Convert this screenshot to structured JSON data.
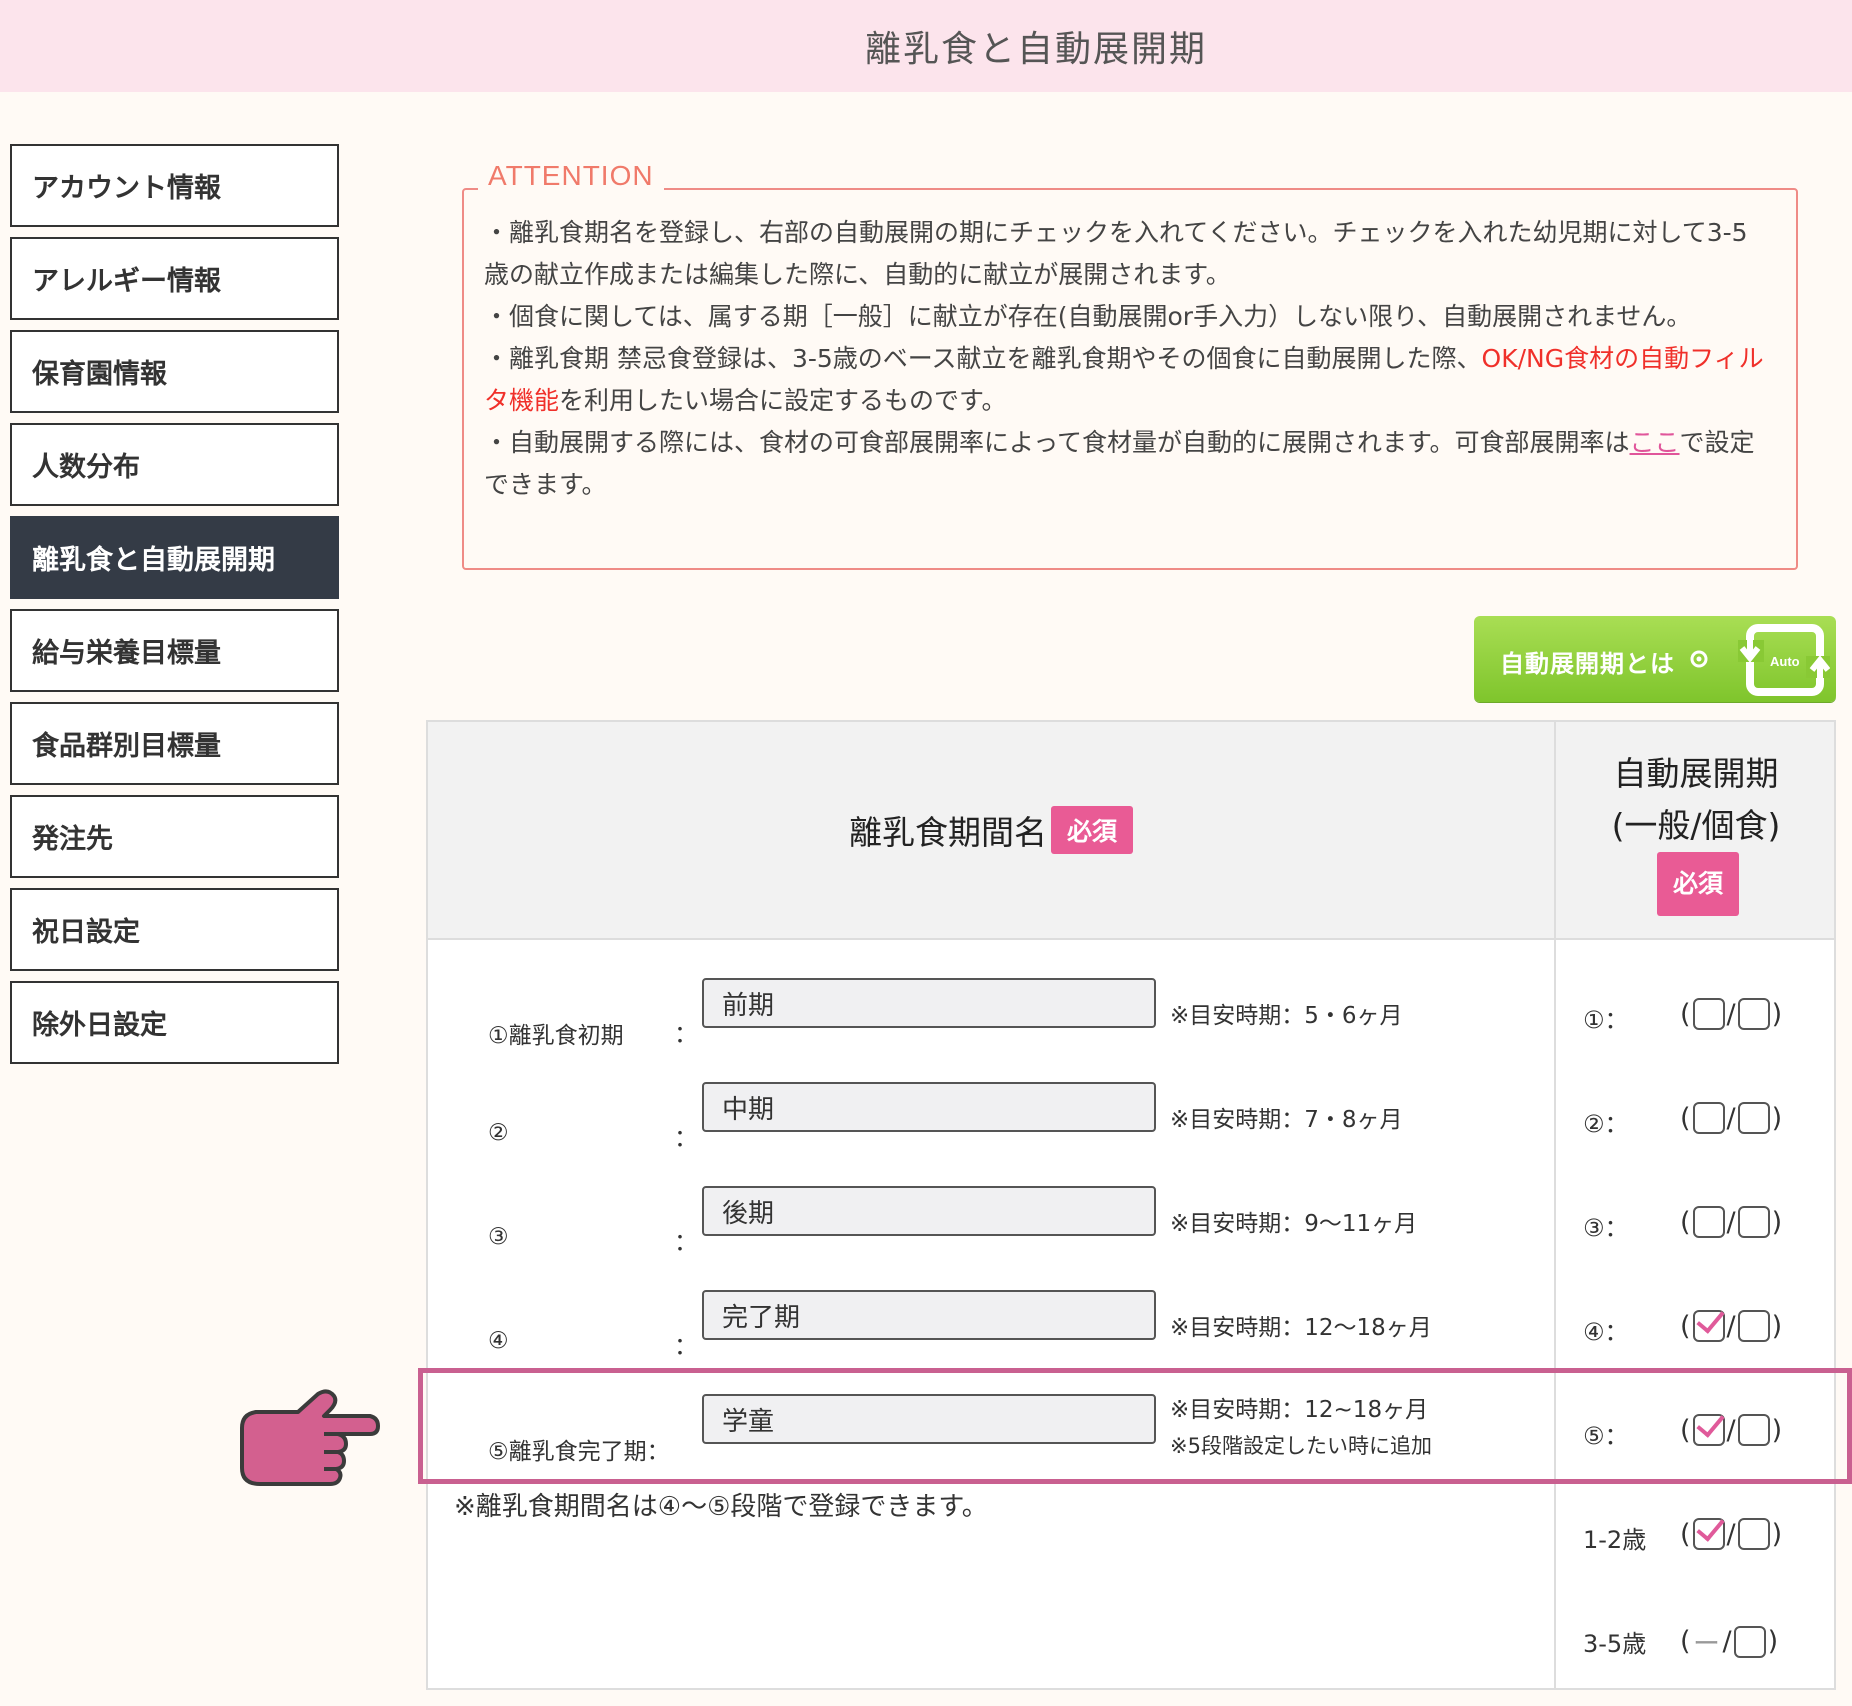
{
  "header": {
    "title": "離乳食と自動展開期"
  },
  "sidebar": {
    "items": [
      {
        "label": "アカウント情報"
      },
      {
        "label": "アレルギー情報"
      },
      {
        "label": "保育園情報"
      },
      {
        "label": "人数分布"
      },
      {
        "label": "離乳食と自動展開期",
        "active": true
      },
      {
        "label": "給与栄養目標量"
      },
      {
        "label": "食品群別目標量"
      },
      {
        "label": "発注先"
      },
      {
        "label": "祝日設定"
      },
      {
        "label": "除外日設定"
      }
    ]
  },
  "attention": {
    "title": "ATTENTION",
    "p1": "・離乳食期名を登録し、右部の自動展開の期にチェックを入れてください。チェックを入れた幼児期に対して3-5歳の献立作成または編集した際に、自動的に献立が展開されます。",
    "p2": "・個食に関しては、属する期［一般］に献立が存在(自動展開or手入力）しない限り、自動展開されません。",
    "p3_a": "・離乳食期 禁忌食登録は、3-5歳のベース献立を離乳食期やその個食に自動展開した際、",
    "p3_red": "OK/NG食材の自動フィルタ機能",
    "p3_b": "を利用したい場合に設定するものです。",
    "p4_a": "・自動展開する際には、食材の可食部展開率によって食材量が自動的に展開されます。可食部展開率は",
    "p4_link": "ここ",
    "p4_b": "で設定できます。"
  },
  "auto_button": {
    "label": "自動展開期とは",
    "icon_text": "Auto"
  },
  "table": {
    "header_name": "離乳食期間名",
    "header_auto_line1": "自動展開期",
    "header_auto_line2": "(一般/個食)",
    "required_badge": "必須",
    "rows": [
      {
        "label": "①離乳食初期",
        "colon": "：",
        "value": "前期",
        "note1": "※目安時期：5・6ヶ月",
        "note2": "",
        "auto_label": "①：",
        "general": false,
        "individual": false
      },
      {
        "label": "②",
        "colon": "：",
        "value": "中期",
        "note1": "※目安時期：7・8ヶ月",
        "note2": "",
        "auto_label": "②：",
        "general": false,
        "individual": false
      },
      {
        "label": "③",
        "colon": "：",
        "value": "後期",
        "note1": "※目安時期：9〜11ヶ月",
        "note2": "",
        "auto_label": "③：",
        "general": false,
        "individual": false
      },
      {
        "label": "④",
        "colon": "：",
        "value": "完了期",
        "note1": "※目安時期：12〜18ヶ月",
        "note2": "",
        "auto_label": "④：",
        "general": true,
        "individual": false
      },
      {
        "label": "⑤離乳食完了期：",
        "colon": "",
        "value": "学童",
        "note1": "※目安時期：12~18ヶ月",
        "note2": "※5段階設定したい時に追加",
        "auto_label": "⑤：",
        "general": true,
        "individual": false
      }
    ],
    "age_rows": [
      {
        "label": "1-2歳",
        "general": true,
        "individual": false
      },
      {
        "label": "3-5歳",
        "general": null,
        "individual": false
      }
    ],
    "note": "※離乳食期間名は④〜⑤段階で登録できます。",
    "paren_open": "(",
    "slash": "/",
    "paren_close": ")",
    "dash": "ー"
  },
  "colors": {
    "accent_pink": "#e95b95",
    "header_bg": "#fce4ec",
    "sidebar_active": "#343b46",
    "button_green": "#8bcb37",
    "attention_border": "#ef8b86"
  }
}
